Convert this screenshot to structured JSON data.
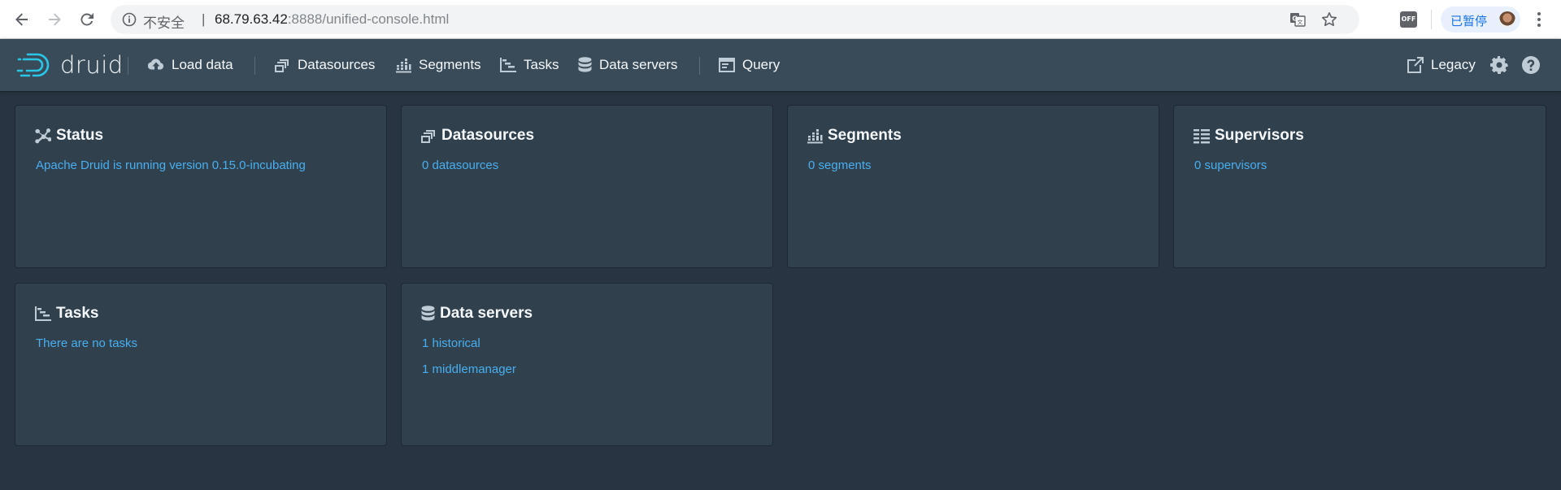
{
  "browser": {
    "insecure_label": "不安全",
    "separator": "|",
    "url_host": "68.79.63.42",
    "url_rest": ":8888/unified-console.html",
    "extension_label": "OFF",
    "profile_status": "已暂停"
  },
  "navbar": {
    "logo_text": "druid",
    "items": [
      {
        "label": "Load data",
        "icon": "cloud-upload-icon"
      },
      {
        "label": "Datasources",
        "icon": "multi-select-icon"
      },
      {
        "label": "Segments",
        "icon": "stacked-chart-icon"
      },
      {
        "label": "Tasks",
        "icon": "gantt-chart-icon"
      },
      {
        "label": "Data servers",
        "icon": "database-icon"
      },
      {
        "label": "Query",
        "icon": "application-icon"
      }
    ],
    "legacy_label": "Legacy",
    "right_icons": [
      "share-icon",
      "cog-icon",
      "help-icon"
    ]
  },
  "cards": {
    "status": {
      "title": "Status",
      "lines": [
        "Apache Druid is running version 0.15.0-incubating"
      ]
    },
    "datasources": {
      "title": "Datasources",
      "lines": [
        "0 datasources"
      ]
    },
    "segments": {
      "title": "Segments",
      "lines": [
        "0 segments"
      ]
    },
    "supervisors": {
      "title": "Supervisors",
      "lines": [
        "0 supervisors"
      ]
    },
    "tasks": {
      "title": "Tasks",
      "lines": [
        "There are no tasks"
      ]
    },
    "dataservers": {
      "title": "Data servers",
      "lines": [
        "1 historical",
        "1 middlemanager"
      ]
    }
  },
  "colors": {
    "page_bg": "#283441",
    "navbar_bg": "#394b59",
    "card_bg": "#30404d",
    "link": "#48aff0",
    "logo_accent": "#2ac6e8"
  }
}
